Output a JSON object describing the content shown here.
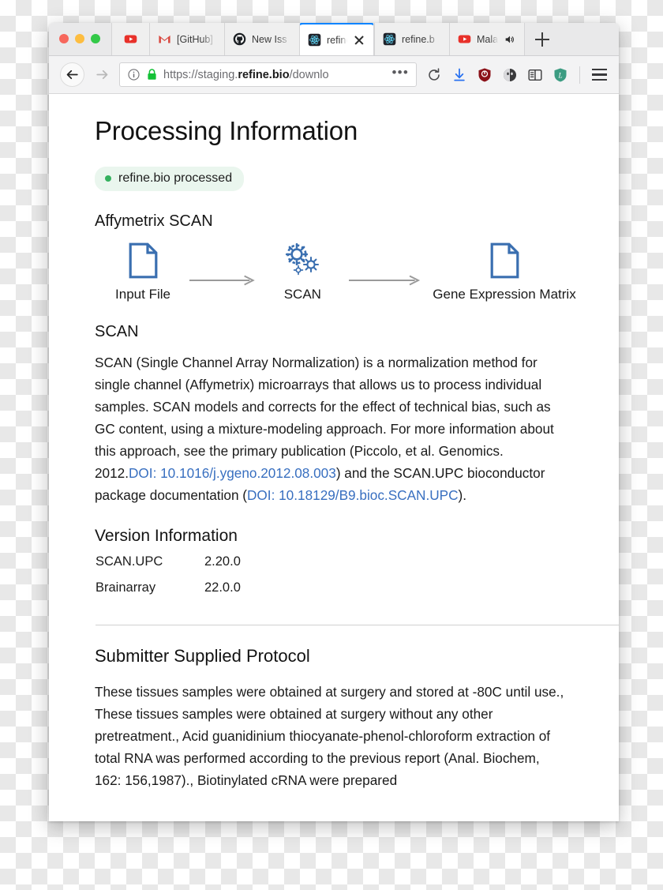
{
  "browser": {
    "traffic_lights": [
      "close",
      "minimize",
      "zoom"
    ],
    "tabs": [
      {
        "label": "",
        "favicon": "youtube-icon",
        "active": false,
        "width": "narrow"
      },
      {
        "label": "[GitHub]",
        "favicon": "gmail-icon",
        "active": false,
        "width": "wide"
      },
      {
        "label": "New Iss",
        "favicon": "github-icon",
        "active": false,
        "width": "wide"
      },
      {
        "label": "refine",
        "favicon": "refinebio-icon",
        "active": true,
        "width": "wide"
      },
      {
        "label": "refine.b",
        "favicon": "refinebio-icon",
        "active": false,
        "width": "wide"
      },
      {
        "label": "Mala",
        "favicon": "youtube-icon",
        "active": false,
        "width": "wide"
      }
    ],
    "new_tab_label": "+",
    "nav": {
      "back_label": "Back",
      "forward_label": "Forward",
      "url_prefix": "https://staging.",
      "url_domain": "refine.bio",
      "url_suffix": "/downlo",
      "url_full": "https://staging.refine.bio/downlo",
      "page_actions_label": "•••",
      "reload_label": "Reload",
      "toolbar_icons": [
        "reload-icon",
        "downloads-icon",
        "ublock-origin-icon",
        "privacy-badger-icon",
        "reader-view-icon",
        "grammarly-icon"
      ],
      "menu_label": "Open menu"
    }
  },
  "page": {
    "title": "Processing Information",
    "status_badge": "refine.bio processed",
    "pipeline": {
      "heading": "Affymetrix SCAN",
      "nodes": [
        {
          "label": "Input File",
          "icon": "file-icon"
        },
        {
          "label": "SCAN",
          "icon": "gears-icon"
        },
        {
          "label": "Gene Expression Matrix",
          "icon": "file-icon"
        }
      ]
    },
    "scan": {
      "heading": "SCAN",
      "paragraph_part1": "SCAN (Single Channel Array Normalization) is a normalization method for single channel (Affymetrix) microarrays that allows us to process individual samples. SCAN models and corrects for the effect of technical bias, such as GC content, using a mixture-modeling approach. For more information about this approach, see the primary publication (Piccolo, et al. Genomics. 2012.",
      "link1": "DOI: 10.1016/j.ygeno.2012.08.003",
      "paragraph_part2": ") and the SCAN.UPC bioconductor package documentation (",
      "link2": "DOI: 10.18129/B9.bioc.SCAN.UPC",
      "paragraph_part3": ")."
    },
    "version_information": {
      "heading": "Version Information",
      "rows": [
        {
          "name": "SCAN.UPC",
          "version": "2.20.0"
        },
        {
          "name": "Brainarray",
          "version": "22.0.0"
        }
      ]
    },
    "protocol": {
      "heading": "Submitter Supplied Protocol",
      "text": "These tissues samples were obtained at surgery and stored at -80C until use., These tissues samples were obtained at surgery without any other pretreatment., Acid guanidinium thiocyanate-phenol-chloroform extraction of total RNA was performed according to the previous report (Anal. Biochem, 162: 156,1987)., Biotinylated cRNA were prepared"
    }
  },
  "colors": {
    "accent_blue": "#386fc0",
    "status_green": "#35b15f",
    "badge_bg": "#eaf6ee",
    "active_tab_indicator": "#0a84ff",
    "diagram_blue": "#3a6fb0"
  }
}
